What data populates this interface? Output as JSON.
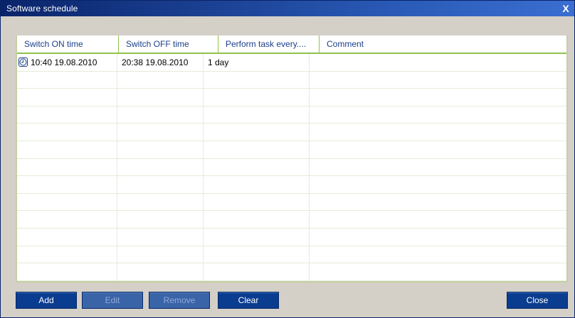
{
  "window": {
    "title": "Software schedule",
    "close_glyph": "X"
  },
  "table": {
    "columns": [
      "Switch ON time",
      "Switch OFF time",
      "Perform task every....",
      "Comment"
    ],
    "rows": [
      {
        "icon": "clock-icon",
        "on": "10:40 19.08.2010",
        "off": "20:38 19.08.2010",
        "every": "1 day",
        "comment": ""
      }
    ]
  },
  "buttons": {
    "add": "Add",
    "edit": "Edit",
    "remove": "Remove",
    "clear": "Clear",
    "close": "Close"
  },
  "colors": {
    "title_bar": "#0a246a",
    "button": "#0a3c8f",
    "header_text": "#1a3f8a",
    "header_rule": "#8fc34a"
  }
}
